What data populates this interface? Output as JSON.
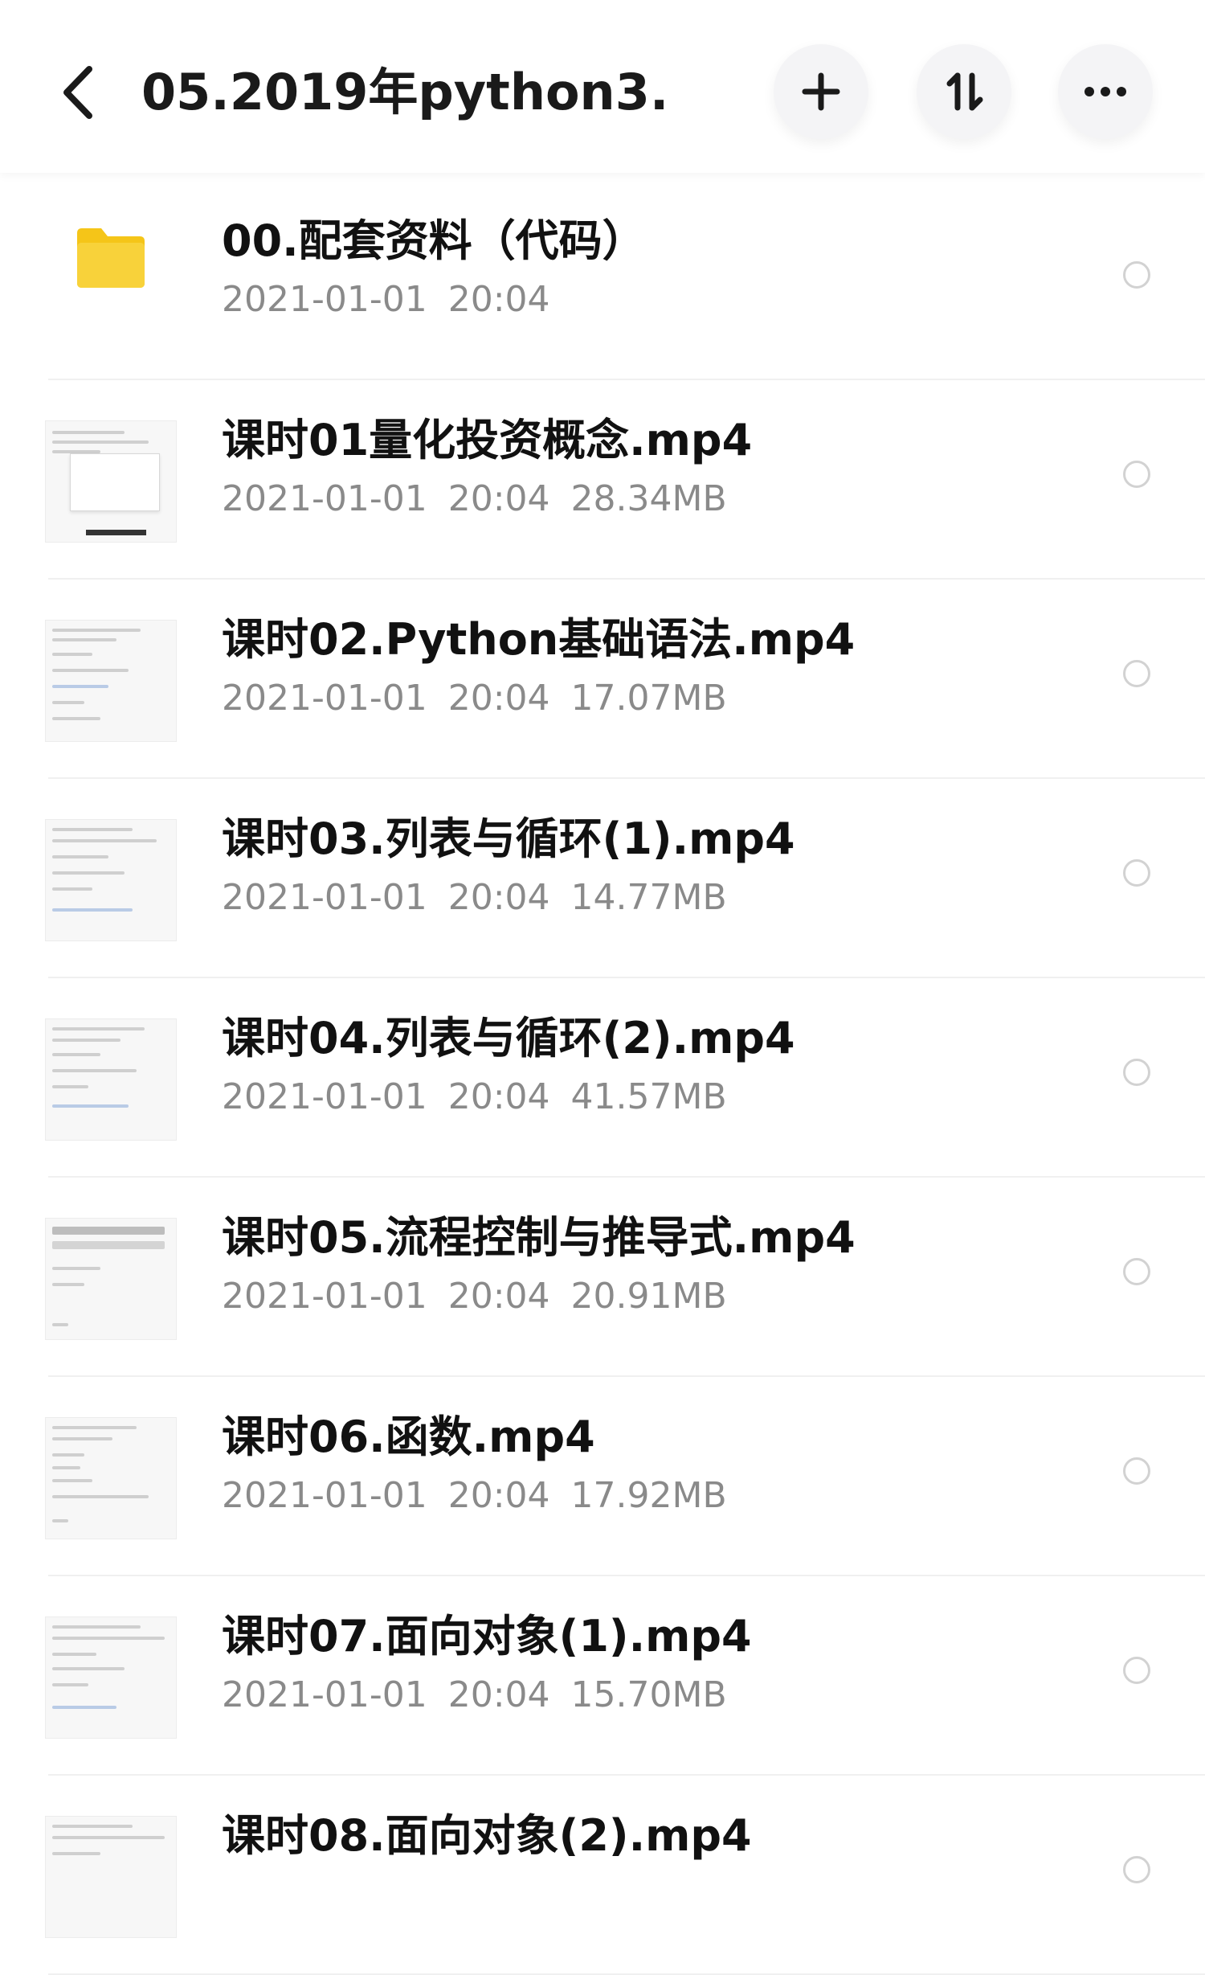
{
  "header": {
    "title": "05.2019年python3....",
    "back_icon": "back-arrow-icon",
    "add_icon": "plus-icon",
    "sort_icon": "sort-icon",
    "more_icon": "more-dots-icon"
  },
  "colors": {
    "folder": "#f5c518",
    "meta_text": "#8a8a8a",
    "divider": "#f0f0f0"
  },
  "files": [
    {
      "name": "00.配套资料（代码）",
      "date": "2021-01-01",
      "time": "20:04",
      "size": "",
      "type": "folder"
    },
    {
      "name": "课时01量化投资概念.mp4",
      "date": "2021-01-01",
      "time": "20:04",
      "size": "28.34MB",
      "type": "video"
    },
    {
      "name": "课时02.Python基础语法.mp4",
      "date": "2021-01-01",
      "time": "20:04",
      "size": "17.07MB",
      "type": "video"
    },
    {
      "name": "课时03.列表与循环(1).mp4",
      "date": "2021-01-01",
      "time": "20:04",
      "size": "14.77MB",
      "type": "video"
    },
    {
      "name": "课时04.列表与循环(2).mp4",
      "date": "2021-01-01",
      "time": "20:04",
      "size": "41.57MB",
      "type": "video"
    },
    {
      "name": "课时05.流程控制与推导式.mp4",
      "date": "2021-01-01",
      "time": "20:04",
      "size": "20.91MB",
      "type": "video"
    },
    {
      "name": "课时06.函数.mp4",
      "date": "2021-01-01",
      "time": "20:04",
      "size": "17.92MB",
      "type": "video"
    },
    {
      "name": "课时07.面向对象(1).mp4",
      "date": "2021-01-01",
      "time": "20:04",
      "size": "15.70MB",
      "type": "video"
    },
    {
      "name": "课时08.面向对象(2).mp4",
      "date": "",
      "time": "",
      "size": "",
      "type": "video"
    }
  ]
}
